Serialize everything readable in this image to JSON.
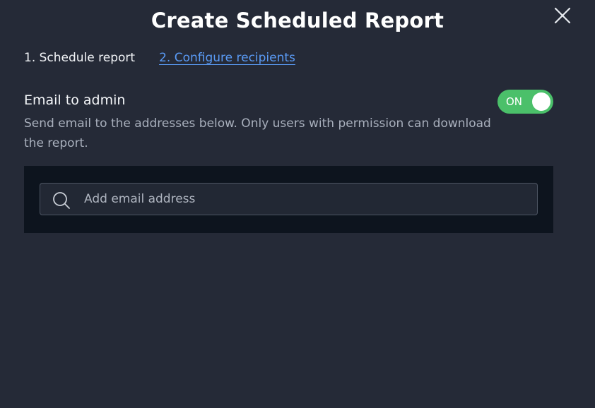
{
  "dialog": {
    "title": "Create Scheduled Report",
    "close_icon": "close-icon"
  },
  "steps": [
    {
      "label": "1. Schedule report",
      "state": "current"
    },
    {
      "label": "2. Configure recipients",
      "state": "link"
    }
  ],
  "email_admin": {
    "title": "Email to admin",
    "description": "Send email to the addresses below. Only users with permission can download the report.",
    "toggle": {
      "label": "ON",
      "state": "on",
      "color": "#4bc06a"
    }
  },
  "recipients": {
    "search_icon": "search-icon",
    "input_value": "",
    "placeholder": "Add email address"
  },
  "colors": {
    "background": "#252a37",
    "panel": "#0d141e",
    "link": "#5a9bf6",
    "toggle_on": "#4bc06a"
  }
}
